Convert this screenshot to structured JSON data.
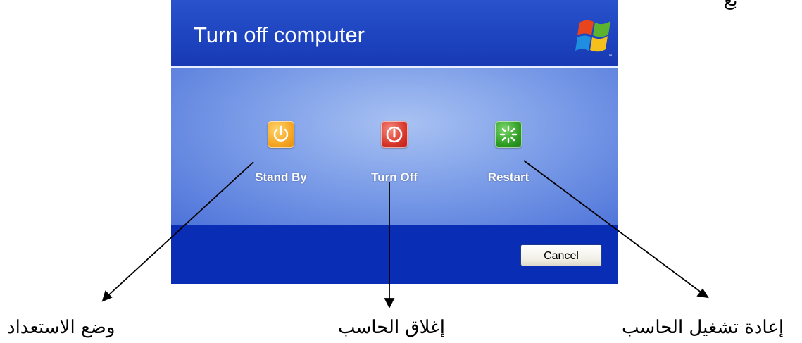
{
  "corner_text": "بع",
  "dialog": {
    "title": "Turn off computer",
    "logo_icon": "windows-xp-flag-icon",
    "options": [
      {
        "id": "standby",
        "label": "Stand By",
        "icon": "power-icon",
        "color": "#f5a623"
      },
      {
        "id": "turnoff",
        "label": "Turn Off",
        "icon": "power-off-icon",
        "color": "#d7362a"
      },
      {
        "id": "restart",
        "label": "Restart",
        "icon": "restart-icon",
        "color": "#2e9d24"
      }
    ],
    "cancel_label": "Cancel"
  },
  "annotations": [
    {
      "id": "standby",
      "text": "وضع الاستعداد"
    },
    {
      "id": "turnoff",
      "text": "إغلاق الحاسب"
    },
    {
      "id": "restart",
      "text": "إعادة تشغيل الحاسب"
    }
  ]
}
